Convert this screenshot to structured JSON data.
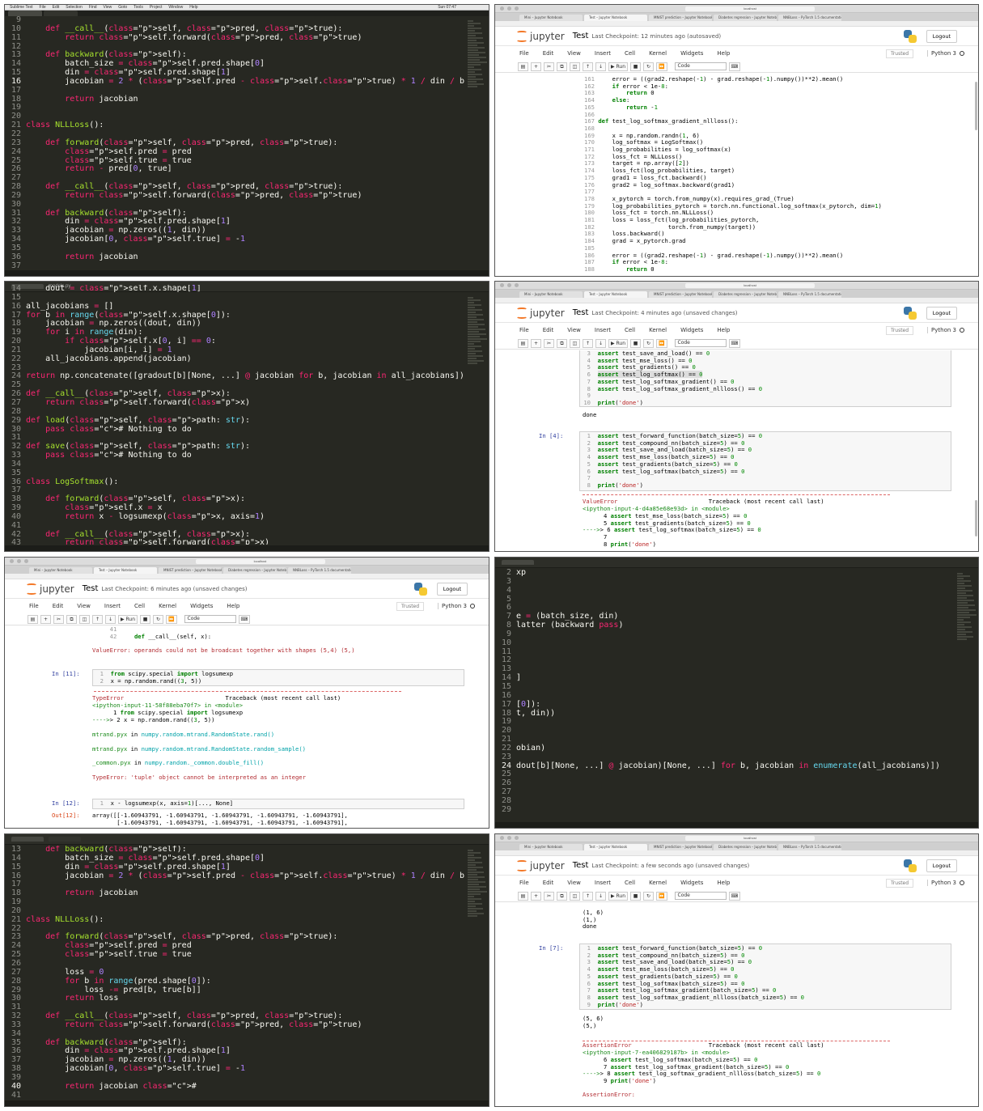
{
  "editor_menu": [
    "Sublime Text",
    "File",
    "Edit",
    "Selection",
    "Find",
    "View",
    "Goto",
    "Tools",
    "Project",
    "Window",
    "Help"
  ],
  "editor_menu_right": "Sun 07:47",
  "editor_filename": "models.py",
  "notebook": {
    "logo": "jupyter",
    "name": "Test",
    "menus": [
      "File",
      "Edit",
      "View",
      "Insert",
      "Cell",
      "Kernel",
      "Widgets",
      "Help"
    ],
    "trusted": "Trusted",
    "kernel": "Python 3",
    "logout": "Logout",
    "run_label": "Run",
    "cell_type": "Code",
    "tabs": [
      "Mini – Jupyter Notebook",
      "Test – Jupyter Notebook",
      "MNIST prediction – Jupyter Notebook",
      "Diabetes regression – Jupyter Notebook",
      "NNBLoss – PyTorch 1.5 documentation"
    ],
    "checkpoints": {
      "t2": "Last Checkpoint: 12 minutes ago  (autosaved)",
      "t4": "Last Checkpoint: 4 minutes ago  (unsaved changes)",
      "t5": "Last Checkpoint: 6 minutes ago  (unsaved changes)",
      "t8": "Last Checkpoint: a few seconds ago  (unsaved changes)"
    }
  },
  "tile1": {
    "start": 9,
    "current": 16,
    "lines": [
      "",
      "    def __call__(self, pred, true):",
      "        return self.forward(pred, true)",
      "",
      "    def backward(self):",
      "        batch_size = self.pred.shape[0]",
      "        din = self.pred.shape[1]",
      "        jacobian = 2 * (self.pred - self.true) * 1 / din / batch_size",
      "",
      "        return jacobian",
      "",
      "",
      "class NLLLoss():",
      "",
      "    def forward(self, pred, true):",
      "        self.pred = pred",
      "        self.true = true",
      "        return - pred[0, true]",
      "",
      "    def __call__(self, pred, true):",
      "        return self.forward(pred, true)",
      "",
      "    def backward(self):",
      "        din = self.pred.shape[1]",
      "        jacobian = np.zeros((1, din))",
      "        jacobian[0, self.true] = -1",
      "",
      "        return jacobian",
      ""
    ]
  },
  "tile2": {
    "start": 161,
    "lines": [
      "    error = ((grad2.reshape(-1) - grad.reshape(-1).numpy())**2).mean()",
      "    if error < 1e-8:",
      "        return 0",
      "    else:",
      "        return -1",
      "",
      "def test_log_softmax_gradient_nllloss():",
      "",
      "    x = np.random.randn(1, 6)",
      "    log_softmax = LogSoftmax()",
      "    log_probabilities = log_softmax(x)",
      "    loss_fct = NLLLoss()",
      "    target = np.array([2])",
      "    loss_fct(log_probabilities, target)",
      "    grad1 = loss_fct.backward()",
      "    grad2 = log_softmax.backward(grad1)",
      "",
      "    x_pytorch = torch.from_numpy(x).requires_grad_(True)",
      "    log_probabilities_pytorch = torch.nn.functional.log_softmax(x_pytorch, dim=1)",
      "    loss_fct = torch.nn.NLLLoss()",
      "    loss = loss_fct(log_probabilities_pytorch,",
      "                    torch.from_numpy(target))",
      "    loss.backward()",
      "    grad = x_pytorch.grad",
      "",
      "    error = ((grad2.reshape(-1) - grad.reshape(-1).numpy())**2).mean()",
      "    if error < 1e-8:",
      "        return 0"
    ]
  },
  "tile3": {
    "start": 14,
    "lines": [
      "    dout = self.x.shape[1]",
      "",
      "all_jacobians = []",
      "for b in range(self.x.shape[0]):",
      "    jacobian = np.zeros((dout, din))",
      "    for i in range(din):",
      "        if self.x[0, i] == 0:",
      "            jacobian[i, i] = 1",
      "    all_jacobians.append(jacobian)",
      "",
      "return np.concatenate([gradout[b][None, ...] @ jacobian for b, jacobian in all_jacobians]).s",
      "",
      "def __call__(self, x):",
      "    return self.forward(x)",
      "",
      "def load(self, path: str):",
      "    pass # Nothing to do",
      "",
      "def save(self, path: str):",
      "    pass # Nothing to do",
      "",
      "",
      "class LogSoftmax():",
      "",
      "    def forward(self, x):",
      "        self.x = x",
      "        return x - logsumexp(x, axis=1)",
      "",
      "    def __call__(self, x):",
      "        return self.forward(x)"
    ]
  },
  "tile4": {
    "tail_lines": [
      "assert test_save_and_load() == 0",
      "assert test_mse_loss() == 0",
      "assert test_gradients() == 0",
      "assert test_log_softmax() == 0",
      "assert test_log_softmax_gradient() == 0",
      "assert test_log_softmax_gradient_nllloss() == 0",
      "",
      "print('done')"
    ],
    "tail_start": 3,
    "output1": "done",
    "prompt": "In [4]:",
    "cell_lines": [
      "assert test_forward_function(batch_size=5) == 0",
      "assert test_compound_nn(batch_size=5) == 0",
      "assert test_save_and_load(batch_size=5) == 0",
      "assert test_mse_loss(batch_size=5) == 0",
      "assert test_gradients(batch_size=5) == 0",
      "assert test_log_softmax(batch_size=5) == 0",
      "",
      "print('done')"
    ],
    "error_name": "ValueError",
    "traceback_label": "Traceback (most recent call last)",
    "error_location": "<ipython-input-4-d4a85e68e93d> in <module>",
    "tb_lines": [
      "      4 assert test_mse_loss(batch_size=5) == 0",
      "      5 assert test_gradients(batch_size=5) == 0",
      "----> 6 assert test_log_softmax(batch_size=5) == 0",
      "      7",
      "      8 print('done')"
    ]
  },
  "tile5": {
    "top_lines": [
      "     41",
      "     42     def __call__(self, x):"
    ],
    "value_error": "ValueError: operands could not be broadcast together with shapes (5,4) (5,)",
    "prompt1": "In [11]:",
    "cell1": [
      "from scipy.special import logsumexp",
      "x = np.random.rand((3, 5))"
    ],
    "error_name": "TypeError",
    "traceback_label": "Traceback (most recent call last)",
    "error_location": "<ipython-input-11-58f88eba70f7> in <module>",
    "tb": [
      "      1 from scipy.special import logsumexp",
      "----> 2 x = np.random.rand((3, 5))"
    ],
    "frames": [
      "mtrand.pyx in numpy.random.mtrand.RandomState.rand()",
      "mtrand.pyx in numpy.random.mtrand.RandomState.random_sample()",
      "_common.pyx in numpy.random._common.double_fill()"
    ],
    "final_error": "TypeError: 'tuple' object cannot be interpreted as an integer",
    "prompt2": "In [12]:",
    "cell2": "x - logsumexp(x, axis=1)[..., None]",
    "out_prompt": "Out[12]:",
    "out_lines": [
      "array([[-1.60943791, -1.60943791, -1.60943791, -1.60943791, -1.60943791],",
      "       [-1.60943791, -1.60943791, -1.60943791, -1.60943791, -1.60943791],"
    ]
  },
  "tile6": {
    "start": 2,
    "lines": [
      "xp",
      "",
      "",
      "",
      "",
      "e = (batch_size, din)",
      "latter (backward pass)",
      "",
      "",
      "",
      "",
      "",
      "]",
      "",
      "",
      "[0]):",
      "t, din))",
      "",
      "",
      "",
      "obian)",
      "",
      "dout[b][None, ...] @ jacobian)[None, ...] for b, jacobian in enumerate(all_jacobians)])",
      "",
      "",
      "",
      "",
      ""
    ]
  },
  "tile7": {
    "start": 13,
    "lines": [
      "    def backward(self):",
      "        batch_size = self.pred.shape[0]",
      "        din = self.pred.shape[1]",
      "        jacobian = 2 * (self.pred - self.true) * 1 / din / batch_size",
      "",
      "        return jacobian",
      "",
      "",
      "class NLLLoss():",
      "",
      "    def forward(self, pred, true):",
      "        self.pred = pred",
      "        self.true = true",
      "",
      "        loss = 0",
      "        for b in range(pred.shape[0]):",
      "            loss -= pred[b, true[b]]",
      "        return loss",
      "",
      "    def __call__(self, pred, true):",
      "        return self.forward(pred, true)",
      "",
      "    def backward(self):",
      "        din = self.pred.shape[1]",
      "        jacobian = np.zeros((1, din))",
      "        jacobian[0, self.true] = -1",
      "",
      "        return jacobian #",
      ""
    ]
  },
  "tile8": {
    "head_lines": [
      "(1, 6)",
      "(1,)",
      "done"
    ],
    "prompt": "In [7]:",
    "cell_lines": [
      "assert test_forward_function(batch_size=5) == 0",
      "assert test_compound_nn(batch_size=5) == 0",
      "assert test_save_and_load(batch_size=5) == 0",
      "assert test_mse_loss(batch_size=5) == 0",
      "assert test_gradients(batch_size=5) == 0",
      "assert test_log_softmax(batch_size=5) == 0",
      "assert test_log_softmax_gradient(batch_size=5) == 0",
      "assert test_log_softmax_gradient_nllloss(batch_size=5) == 0",
      "print('done')"
    ],
    "out_lines": [
      "(5, 6)",
      "(5,)"
    ],
    "error_name": "AssertionError",
    "traceback_label": "Traceback (most recent call last)",
    "error_location": "<ipython-input-7-ea406829187b> in <module>",
    "tb_lines": [
      "      6 assert test_log_softmax(batch_size=5) == 0",
      "      7 assert test_log_softmax_gradient(batch_size=5) == 0",
      "----> 8 assert test_log_softmax_gradient_nllloss(batch_size=5) == 0",
      "      9 print('done')"
    ],
    "final_error": "AssertionError:"
  }
}
